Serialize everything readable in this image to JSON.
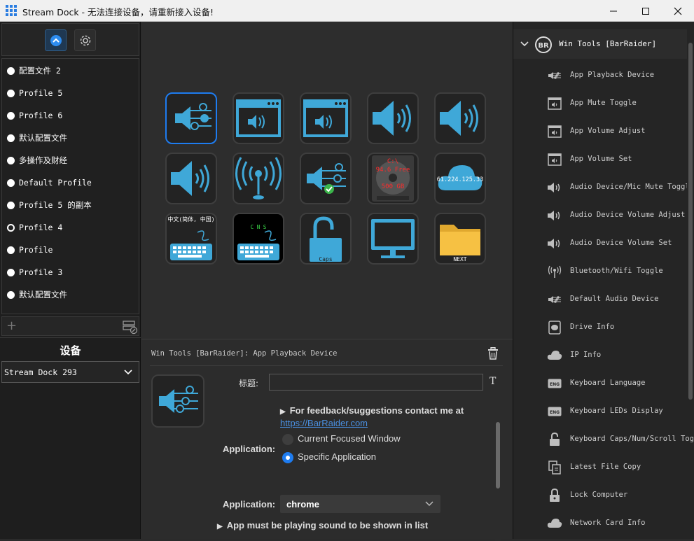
{
  "window": {
    "title": "Stream Dock - 无法连接设备，请重新接入设备!",
    "minimize_label": "—",
    "maximize_label": "☐",
    "close_label": "✕"
  },
  "sidebar": {
    "profiles": [
      {
        "label": "配置文件 2",
        "selected": false
      },
      {
        "label": "Profile 5",
        "selected": false
      },
      {
        "label": "Profile 6",
        "selected": false
      },
      {
        "label": "默认配置文件",
        "selected": false
      },
      {
        "label": "多操作及财经",
        "selected": false
      },
      {
        "label": "Default Profile",
        "selected": false
      },
      {
        "label": "Profile 5 的副本",
        "selected": false
      },
      {
        "label": "Profile 4",
        "selected": true
      },
      {
        "label": "Profile",
        "selected": false
      },
      {
        "label": "Profile 3",
        "selected": false
      },
      {
        "label": "默认配置文件",
        "selected": false
      }
    ],
    "add_label": "+",
    "device_heading": "设备",
    "device_selected": "Stream Dock 293"
  },
  "keys": {
    "drive_text_lines": [
      "C:\\",
      "94.6 Free",
      "500 GB"
    ],
    "ip_text": "61.224.125.33",
    "kb1_text": "中文(简体, 中国)",
    "kb2_text": "C    N    S",
    "caps_text": "Caps",
    "next_text": "NEXT"
  },
  "inspector": {
    "title": "Win Tools [BarRaider]: App Playback Device",
    "title_field_label": "标题:",
    "title_value": "",
    "t_button": "T",
    "feedback_text": "For feedback/suggestions contact me at",
    "feedback_link": "https://BarRaider.com",
    "application_label": "Application:",
    "radio_current": "Current Focused Window",
    "radio_specific": "Specific Application",
    "application_select_label": "Application:",
    "application_value": "chrome",
    "playing_note": "App must be playing sound to be shown in list"
  },
  "plugin": {
    "name": "Win Tools [BarRaider]",
    "actions": [
      {
        "label": "App Playback Device",
        "icon": "playback-icon"
      },
      {
        "label": "App Mute Toggle",
        "icon": "window-speaker-icon"
      },
      {
        "label": "App Volume Adjust",
        "icon": "window-speaker-icon"
      },
      {
        "label": "App Volume Set",
        "icon": "window-speaker-icon"
      },
      {
        "label": "Audio Device/Mic Mute Toggle",
        "icon": "speaker-icon"
      },
      {
        "label": "Audio Device Volume Adjust",
        "icon": "speaker-icon"
      },
      {
        "label": "Audio Device Volume Set",
        "icon": "speaker-icon"
      },
      {
        "label": "Bluetooth/Wifi Toggle",
        "icon": "antenna-icon"
      },
      {
        "label": "Default Audio Device",
        "icon": "playback-icon"
      },
      {
        "label": "Drive Info",
        "icon": "drive-icon"
      },
      {
        "label": "IP Info",
        "icon": "cloud-icon"
      },
      {
        "label": "Keyboard Language",
        "icon": "keyboard-eng-icon"
      },
      {
        "label": "Keyboard LEDs Display",
        "icon": "keyboard-eng-icon"
      },
      {
        "label": "Keyboard Caps/Num/Scroll Toggle",
        "icon": "unlock-icon"
      },
      {
        "label": "Latest File Copy",
        "icon": "file-copy-icon"
      },
      {
        "label": "Lock Computer",
        "icon": "lock-icon"
      },
      {
        "label": "Network Card Info",
        "icon": "cloud-icon"
      }
    ]
  },
  "colors": {
    "accent": "#1e7cf0",
    "icon_blue": "#3fa8d8",
    "folder_yellow": "#f6c143"
  }
}
